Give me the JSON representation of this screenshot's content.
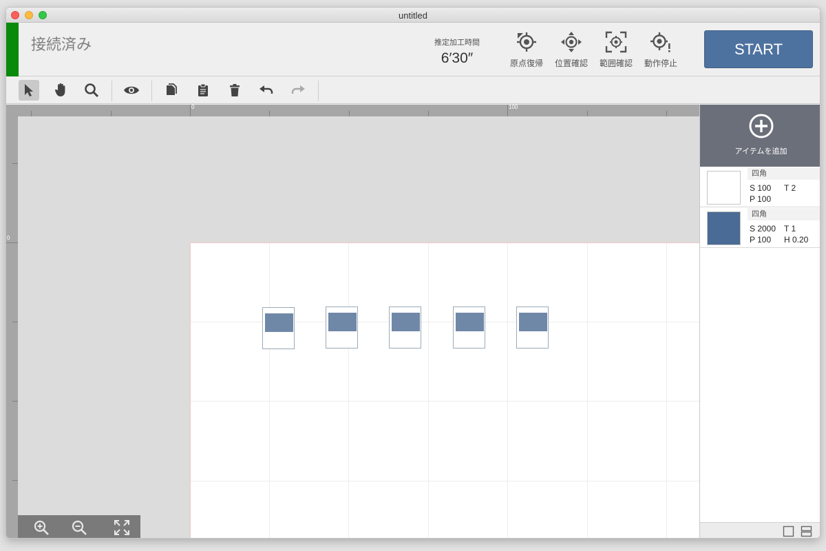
{
  "window": {
    "title": "untitled"
  },
  "header": {
    "status_text": "接続済み",
    "status_color": "#0a8a0a",
    "time_label": "推定加工時間",
    "time_value": "6′30″",
    "buttons": [
      {
        "label": "原点復帰",
        "icon": "home-target-icon"
      },
      {
        "label": "位置確認",
        "icon": "move-target-icon"
      },
      {
        "label": "範囲確認",
        "icon": "frame-target-icon"
      },
      {
        "label": "動作停止",
        "icon": "stop-target-icon"
      }
    ],
    "start_label": "START",
    "start_color": "#4e729f"
  },
  "toolbar": {
    "tools": [
      {
        "name": "select-tool",
        "icon": "pointer-icon",
        "active": true
      },
      {
        "name": "hand-tool",
        "icon": "hand-icon",
        "active": false
      },
      {
        "name": "zoom-tool",
        "icon": "magnifier-icon",
        "active": false
      },
      {
        "name": "preview-tool",
        "icon": "eye-icon",
        "active": false
      },
      {
        "name": "copy-tool",
        "icon": "copy-icon",
        "active": false
      },
      {
        "name": "paste-tool",
        "icon": "clipboard-icon",
        "active": false
      },
      {
        "name": "delete-tool",
        "icon": "trash-icon",
        "active": false
      },
      {
        "name": "undo-tool",
        "icon": "undo-icon",
        "active": false
      },
      {
        "name": "redo-tool",
        "icon": "redo-icon",
        "active": false
      }
    ]
  },
  "canvas": {
    "ruler_top_labels": [
      "0",
      "100"
    ],
    "ruler_left_labels": [
      "0"
    ],
    "shape_count": 5,
    "shape_fill": "#7088a8",
    "zoom_controls": [
      "zoom-in-icon",
      "zoom-out-icon",
      "fit-screen-icon"
    ]
  },
  "panel": {
    "add_item_label": "アイテムを追加",
    "items": [
      {
        "name": "四角",
        "swatch_color": "#ffffff",
        "line1_a": "S 100",
        "line1_b": "T 2",
        "line2_a": "P 100",
        "line2_b": ""
      },
      {
        "name": "四角",
        "swatch_color": "#4a6b95",
        "line1_a": "S 2000",
        "line1_b": "T 1",
        "line2_a": "P 100",
        "line2_b": "H 0.20"
      }
    ],
    "footer_icons": [
      "single-view-icon",
      "split-view-icon"
    ]
  }
}
